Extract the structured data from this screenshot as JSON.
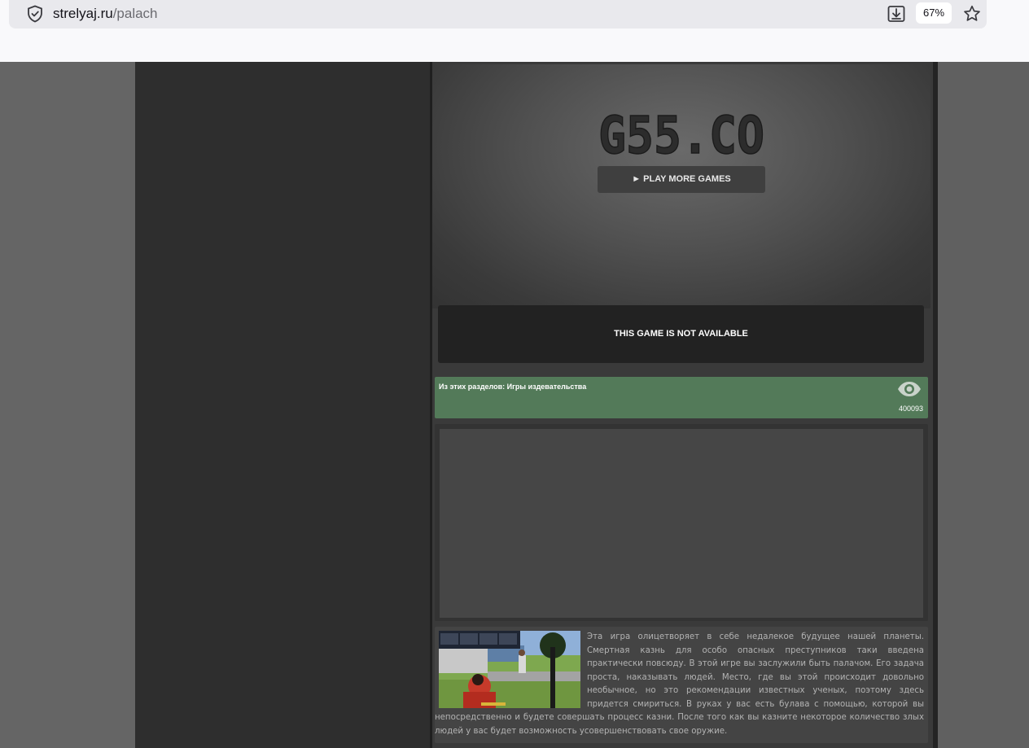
{
  "browser": {
    "url_domain": "strelyaj.ru",
    "url_path": "/palach",
    "zoom": "67%"
  },
  "game": {
    "logo_text": "G55.CO",
    "play_more_label": "► PLAY MORE GAMES",
    "not_available": "THIS GAME IS NOT AVAILABLE"
  },
  "category": {
    "text": "Из этих разделов: Игры издевательства",
    "views": "400093"
  },
  "description": {
    "text": "Эта игра олицетворяет в себе недалекое будущее нашей планеты. Смертная казнь для особо опасных преступников таки введена практически повсюду. В этой игре вы заслужили быть палачом. Его задача проста, наказывать людей. Место, где вы этой происходит довольно необычное, но это рекомендации известных ученых, поэтому здесь придется смириться. В руках у вас есть булава с помощью, которой вы непосредственно и будете совершать процесс казни. После того как вы казните некоторое количество злых людей у вас будет возможность усовершенствовать свое оружие."
  },
  "colors": {
    "category_bar": "#537a59",
    "page_bg": "#656565",
    "left_column": "#2e2e2e"
  }
}
